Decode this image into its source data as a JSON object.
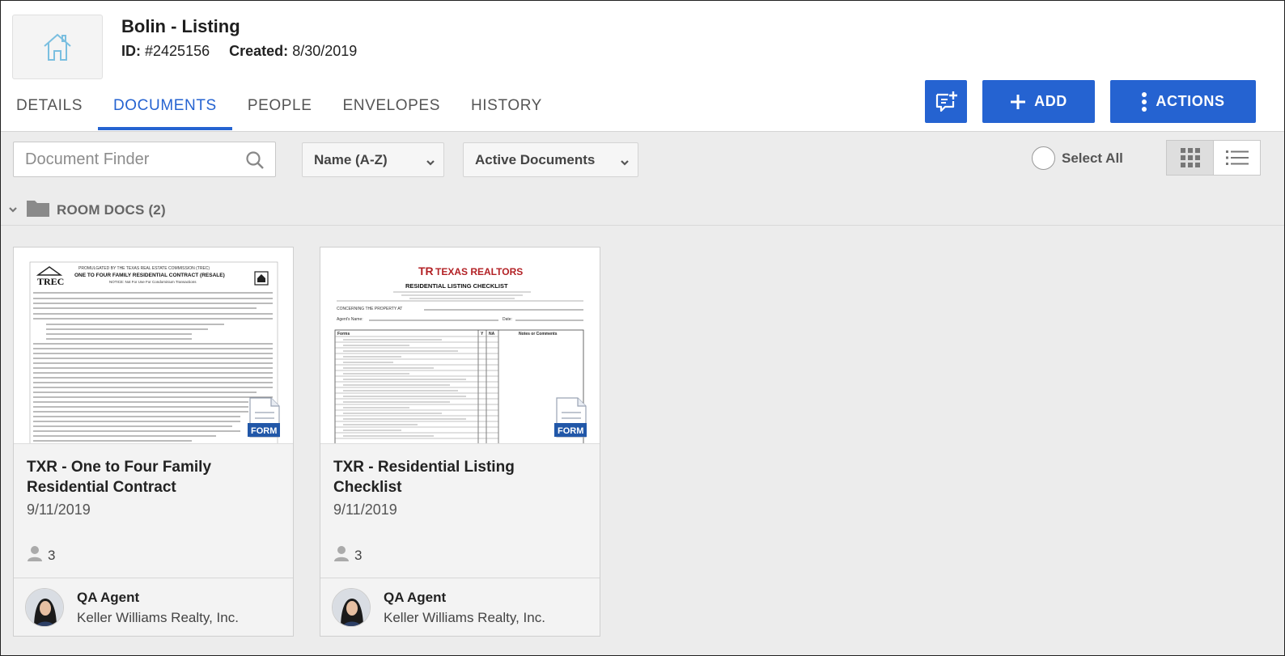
{
  "listing": {
    "title": "Bolin - Listing",
    "id_label": "ID:",
    "id_value": "#2425156",
    "created_label": "Created:",
    "created_value": "8/30/2019"
  },
  "tabs": [
    {
      "label": "DETAILS",
      "active": false
    },
    {
      "label": "DOCUMENTS",
      "active": true
    },
    {
      "label": "PEOPLE",
      "active": false
    },
    {
      "label": "ENVELOPES",
      "active": false
    },
    {
      "label": "HISTORY",
      "active": false
    }
  ],
  "buttons": {
    "add_label": "ADD",
    "actions_label": "ACTIONS",
    "chat_icon": "add-comment-icon"
  },
  "toolbar": {
    "finder_placeholder": "Document Finder",
    "sort_value": "Name (A-Z)",
    "filter_value": "Active Documents",
    "select_all_label": "Select All"
  },
  "folder": {
    "label": "ROOM DOCS (2)"
  },
  "documents": [
    {
      "title": "TXR - One to Four Family Residential Contract",
      "date": "9/11/2019",
      "people_count": "3",
      "badge": "FORM",
      "agent_name": "QA Agent",
      "agent_company": "Keller Williams Realty, Inc.",
      "preview": {
        "header_line": "PROMULGATED BY THE TEXAS REAL ESTATE COMMISSION (TREC)",
        "heading": "ONE TO FOUR FAMILY RESIDENTIAL CONTRACT (RESALE)",
        "notice": "NOTICE: Not For Use For Condominium Transactions",
        "logo": "TREC"
      }
    },
    {
      "title": "TXR - Residential Listing Checklist",
      "date": "9/11/2019",
      "people_count": "3",
      "badge": "FORM",
      "agent_name": "QA Agent",
      "agent_company": "Keller Williams Realty, Inc.",
      "preview": {
        "logo": "TEXAS REALTORS",
        "heading": "RESIDENTIAL LISTING CHECKLIST",
        "line1": "CONCERNING THE PROPERTY AT",
        "line2": "Agent's Name:",
        "line3": "Date:",
        "col_forms": "Forms",
        "col_y": "Y",
        "col_na": "NA",
        "col_notes": "Notes or Comments"
      }
    }
  ],
  "colors": {
    "accent": "#2563d1",
    "badge": "#2157a8"
  }
}
